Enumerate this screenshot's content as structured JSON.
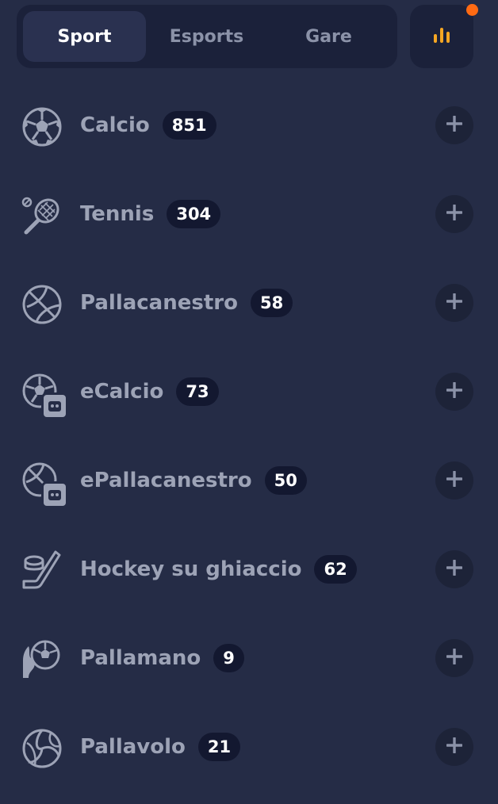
{
  "tabs": [
    {
      "label": "Sport",
      "active": true
    },
    {
      "label": "Esports",
      "active": false
    },
    {
      "label": "Gare",
      "active": false
    }
  ],
  "stats_button": {
    "icon": "bar-chart-icon",
    "accent": "#f5a623",
    "notification_color": "#ff6a13"
  },
  "sports": [
    {
      "label": "Calcio",
      "count": "851",
      "icon": "soccer-ball-icon"
    },
    {
      "label": "Tennis",
      "count": "304",
      "icon": "tennis-racket-icon"
    },
    {
      "label": "Pallacanestro",
      "count": "58",
      "icon": "basketball-icon"
    },
    {
      "label": "eCalcio",
      "count": "73",
      "icon": "esoccer-icon"
    },
    {
      "label": "ePallacanestro",
      "count": "50",
      "icon": "ebasketball-icon"
    },
    {
      "label": "Hockey su ghiaccio",
      "count": "62",
      "icon": "ice-hockey-icon"
    },
    {
      "label": "Pallamano",
      "count": "9",
      "icon": "handball-icon"
    },
    {
      "label": "Pallavolo",
      "count": "21",
      "icon": "volleyball-icon"
    }
  ],
  "colors": {
    "background": "#252c46",
    "panel": "#1b213a",
    "badge": "#131830",
    "text_muted": "#9da3b6"
  }
}
